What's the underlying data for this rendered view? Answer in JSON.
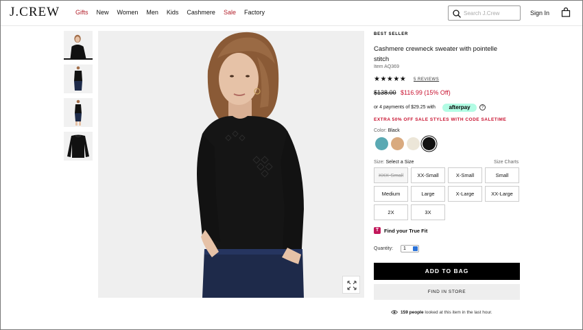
{
  "header": {
    "logo": "J.CREW",
    "nav": [
      {
        "label": "Gifts",
        "highlight": true
      },
      {
        "label": "New",
        "highlight": false
      },
      {
        "label": "Women",
        "highlight": false
      },
      {
        "label": "Men",
        "highlight": false
      },
      {
        "label": "Kids",
        "highlight": false
      },
      {
        "label": "Cashmere",
        "highlight": false
      },
      {
        "label": "Sale",
        "highlight": true
      },
      {
        "label": "Factory",
        "highlight": false
      }
    ],
    "search_placeholder": "Search J.Crew",
    "signin": "Sign In",
    "icons": [
      "search-icon",
      "shopping-bag-icon"
    ]
  },
  "gallery": {
    "thumbnail_count": 4,
    "active_index": 0,
    "zoom_icon": "expand-icon"
  },
  "product": {
    "badge": "BEST SELLER",
    "title": "Cashmere crewneck sweater with pointelle stitch",
    "item_number": "Item AQ369",
    "rating_stars": "★★★★★",
    "rating_value": 5,
    "reviews_link": "5 REVIEWS",
    "price_original": "$138.00",
    "price_sale": "$116.99 (15% Off)",
    "afterpay_text": "or 4 payments of $29.25 with",
    "afterpay_logo": "afterpay",
    "afterpay_info": "?",
    "promo": "EXTRA 50% OFF SALE STYLES WITH CODE SALETIME",
    "color_label": "Color:",
    "color_value": "Black",
    "swatches": [
      {
        "name": "teal",
        "color": "#5aa9b3",
        "selected": false
      },
      {
        "name": "camel",
        "color": "#d9aa7f",
        "selected": false
      },
      {
        "name": "ivory",
        "color": "#ece6d8",
        "selected": false
      },
      {
        "name": "black",
        "color": "#111111",
        "selected": true
      }
    ],
    "size_label": "Size:",
    "size_value": "Select a Size",
    "size_charts": "Size Charts",
    "sizes": [
      {
        "label": "XXX-Small",
        "available": false
      },
      {
        "label": "XX-Small",
        "available": true
      },
      {
        "label": "X-Small",
        "available": true
      },
      {
        "label": "Small",
        "available": true
      },
      {
        "label": "Medium",
        "available": true
      },
      {
        "label": "Large",
        "available": true
      },
      {
        "label": "X-Large",
        "available": true
      },
      {
        "label": "XX-Large",
        "available": true
      },
      {
        "label": "2X",
        "available": true
      },
      {
        "label": "3X",
        "available": true
      }
    ],
    "true_fit_icon": "T",
    "true_fit": "Find your True Fit",
    "quantity_label": "Quantity:",
    "quantity_value": "1",
    "add_to_bag": "ADD TO BAG",
    "find_in_store": "FIND IN STORE",
    "viewers_count": "159 people",
    "viewers_text": "looked at this item in the last hour."
  }
}
